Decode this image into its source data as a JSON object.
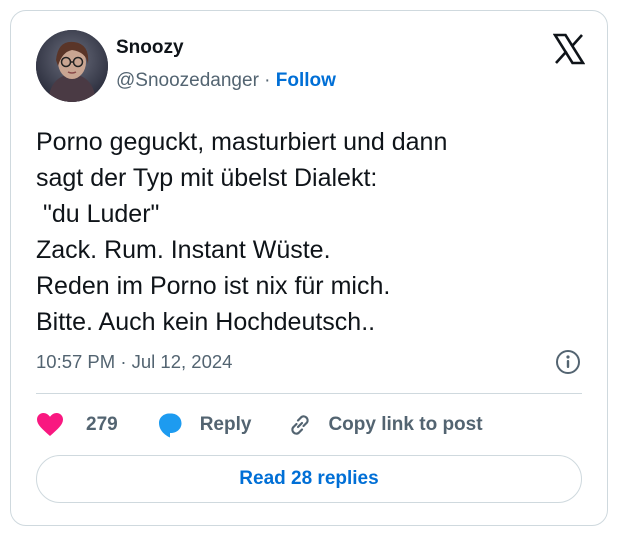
{
  "tweet": {
    "author": {
      "name": "Snoozy",
      "handle": "@Snoozedanger",
      "separator": " · ",
      "follow_label": "Follow"
    },
    "text": "Porno geguckt, masturbiert und dann\nsagt der Typ mit übelst Dialekt:\n \"du Luder\"\nZack. Rum. Instant Wüste.\nReden im Porno ist nix für mich.\nBitte. Auch kein Hochdeutsch..",
    "time": "10:57 PM",
    "date_separator": " · ",
    "date": "Jul 12, 2024"
  },
  "actions": {
    "like_count": "279",
    "reply_label": "Reply",
    "copy_label": "Copy link to post"
  },
  "read_replies_label": "Read 28 replies",
  "colors": {
    "like": "#f91880",
    "reply": "#1d9bf0",
    "link": "#006fd6",
    "muted": "#536471",
    "border": "#cfd9de"
  },
  "icons": [
    "x-logo-icon",
    "info-icon",
    "heart-icon",
    "reply-bubble-icon",
    "link-icon"
  ]
}
